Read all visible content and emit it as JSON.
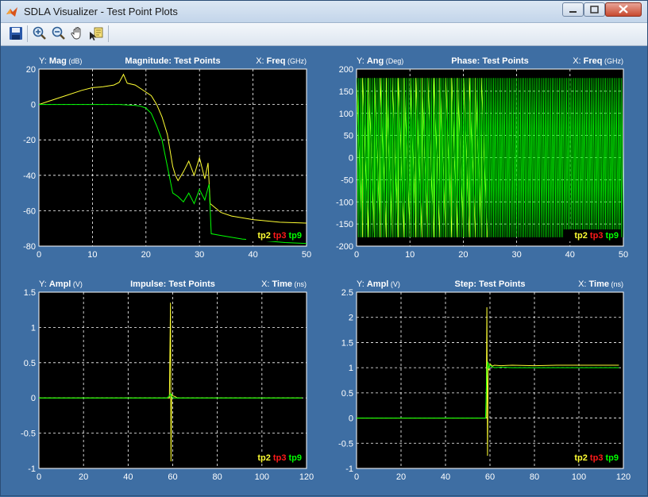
{
  "window": {
    "title": "SDLA Visualizer - Test Point Plots"
  },
  "toolbar": {
    "buttons": [
      "save-icon",
      "zoom-in-icon",
      "zoom-out-icon",
      "pan-hand-icon",
      "data-cursor-icon"
    ]
  },
  "colors": {
    "tp2": "#ffff33",
    "tp3": "#ff1a1a",
    "tp9": "#00ff00",
    "plot_bg": "#000000",
    "frame_bg": "#3e6ea3"
  },
  "legend": [
    "tp2",
    "tp3",
    "tp9"
  ],
  "chart_data": [
    {
      "type": "line",
      "title": "Magnitude: Test Points",
      "y_prefix": "Y:",
      "y_name": "Mag",
      "y_unit": "(dB)",
      "x_prefix": "X:",
      "x_name": "Freq",
      "x_unit": "(GHz)",
      "xlim": [
        0,
        50
      ],
      "ylim": [
        -80,
        20
      ],
      "xticks": [
        "0",
        "10",
        "20",
        "30",
        "40",
        "50"
      ],
      "yticks": [
        "20",
        "0",
        "-20",
        "-40",
        "-60",
        "-80"
      ],
      "grid": true,
      "legend_position": "bottom-right",
      "series": [
        {
          "name": "tp2",
          "x": [
            0,
            2,
            5,
            8,
            10,
            12,
            14,
            15,
            15.8,
            16.5,
            18,
            20,
            21,
            22,
            23,
            24,
            25,
            25.5,
            26,
            27,
            28,
            29,
            30,
            31,
            31.6,
            32,
            34,
            36,
            40,
            45,
            50
          ],
          "y": [
            0,
            2,
            5,
            8,
            9.5,
            10,
            11,
            12.5,
            17,
            12,
            11,
            7,
            5,
            0,
            -7,
            -17,
            -35,
            -40,
            -43,
            -38,
            -32,
            -40,
            -30,
            -42,
            -33,
            -56,
            -61,
            -63,
            -65,
            -66.5,
            -67
          ]
        },
        {
          "name": "tp9",
          "x": [
            0,
            5,
            10,
            15,
            18,
            19,
            20,
            21,
            22,
            23,
            24,
            25,
            26,
            27,
            28,
            29,
            30,
            31,
            31.8,
            32.2,
            34,
            38,
            42,
            46,
            50
          ],
          "y": [
            0,
            0,
            0,
            0,
            -0.5,
            -1,
            -2,
            -5,
            -12,
            -20,
            -35,
            -50,
            -52,
            -55,
            -50,
            -56,
            -48,
            -54,
            -45,
            -73,
            -74,
            -76,
            -77,
            -78,
            -78.5
          ]
        }
      ]
    },
    {
      "type": "line",
      "title": "Phase: Test Points",
      "y_prefix": "Y:",
      "y_name": "Ang",
      "y_unit": "(Deg)",
      "x_prefix": "X:",
      "x_name": "Freq",
      "x_unit": "(GHz)",
      "xlim": [
        0,
        50
      ],
      "ylim": [
        -200,
        200
      ],
      "xticks": [
        "0",
        "10",
        "20",
        "30",
        "40",
        "50"
      ],
      "yticks": [
        "200",
        "150",
        "100",
        "50",
        "0",
        "-50",
        "-100",
        "-150",
        "-200"
      ],
      "grid": true,
      "legend_position": "bottom-right",
      "series": [
        {
          "name": "tp2",
          "pattern": "sawtooth wrapping ±180",
          "x_range": [
            0,
            24.5
          ],
          "wraps": 22,
          "amplitude": 180
        },
        {
          "name": "tp9",
          "pattern": "sawtooth wrapping ±180",
          "x_range": [
            0,
            50
          ],
          "wraps": 150,
          "amplitude": 180
        }
      ]
    },
    {
      "type": "line",
      "title": "Impulse: Test Points",
      "y_prefix": "Y:",
      "y_name": "Ampl",
      "y_unit": "(V)",
      "x_prefix": "X:",
      "x_name": "Time",
      "x_unit": "(ns)",
      "xlim": [
        0,
        120
      ],
      "ylim": [
        -1,
        1.5
      ],
      "xticks": [
        "0",
        "20",
        "40",
        "60",
        "80",
        "100",
        "120"
      ],
      "yticks": [
        "1.5",
        "1",
        "0.5",
        "0",
        "-0.5",
        "-1"
      ],
      "grid": true,
      "legend_position": "bottom-right",
      "series": [
        {
          "name": "tp2",
          "x": [
            0,
            58.5,
            59,
            59.2,
            59.5,
            60,
            61,
            62,
            65,
            118
          ],
          "y": [
            0,
            0,
            1.35,
            -0.9,
            0.05,
            0.03,
            0.02,
            0,
            0,
            0
          ]
        },
        {
          "name": "tp9",
          "x": [
            0,
            57.5,
            58.5,
            59,
            59.5,
            60,
            61,
            118
          ],
          "y": [
            0,
            0,
            0.03,
            0.06,
            0.02,
            0,
            0,
            0
          ]
        }
      ]
    },
    {
      "type": "line",
      "title": "Step: Test Points",
      "y_prefix": "Y:",
      "y_name": "Ampl",
      "y_unit": "(V)",
      "x_prefix": "X:",
      "x_name": "Time",
      "x_unit": "(ns)",
      "xlim": [
        0,
        120
      ],
      "ylim": [
        -1,
        2.5
      ],
      "xticks": [
        "0",
        "20",
        "40",
        "60",
        "80",
        "100",
        "120"
      ],
      "yticks": [
        "2.5",
        "2",
        "1.5",
        "1",
        "0.5",
        "0",
        "-0.5",
        "-1"
      ],
      "grid": true,
      "legend_position": "bottom-right",
      "series": [
        {
          "name": "tp2",
          "x": [
            0,
            58.3,
            58.6,
            58.9,
            59.2,
            59.5,
            60,
            61,
            62,
            65,
            70,
            80,
            90,
            100,
            118
          ],
          "y": [
            0,
            0,
            2.2,
            -0.75,
            1.1,
            0.95,
            1.08,
            1.03,
            1.05,
            1.04,
            1.05,
            1.04,
            1.05,
            1.05,
            1.05
          ]
        },
        {
          "name": "tp9",
          "x": [
            0,
            58,
            58.6,
            59,
            59.5,
            60,
            61,
            62,
            65,
            70,
            80,
            118
          ],
          "y": [
            0,
            0,
            0.95,
            1.12,
            0.98,
            1.05,
            1.02,
            1.0,
            1.01,
            1.0,
            1.0,
            1.0
          ]
        }
      ]
    }
  ]
}
